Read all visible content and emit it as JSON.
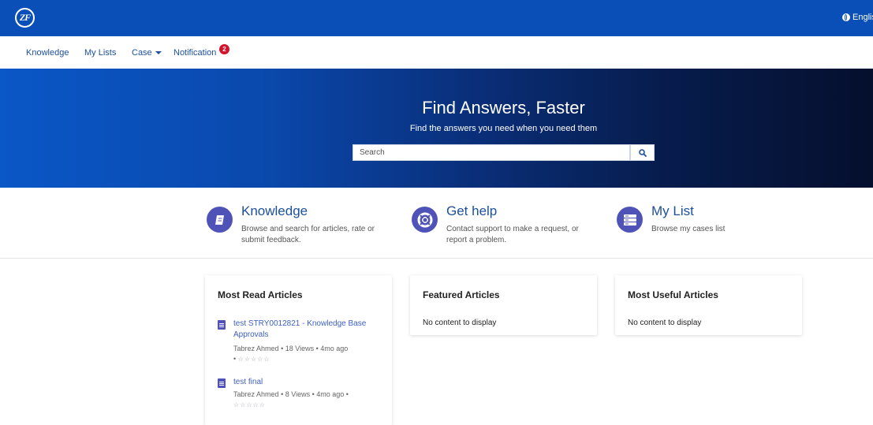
{
  "header": {
    "logo_text": "ZF",
    "language": "Englis"
  },
  "nav": {
    "items": [
      {
        "label": "Knowledge"
      },
      {
        "label": "My Lists"
      },
      {
        "label": "Case"
      },
      {
        "label": "Notification"
      }
    ],
    "notification_count": "2"
  },
  "hero": {
    "title": "Find Answers, Faster",
    "subtitle": "Find the answers you need when you need them",
    "search_placeholder": "Search"
  },
  "features": [
    {
      "title": "Knowledge",
      "description": "Browse and search for articles, rate or submit feedback.",
      "icon": "book-icon"
    },
    {
      "title": "Get help",
      "description": "Contact support to make a request, or report a problem.",
      "icon": "lifebuoy-icon"
    },
    {
      "title": "My List",
      "description": "Browse my cases list",
      "icon": "list-server-icon"
    }
  ],
  "cards": {
    "most_read": {
      "title": "Most Read Articles",
      "articles": [
        {
          "title": "test STRY0012821 - Knowledge Base Approvals",
          "author": "Tabrez Ahmed",
          "views": "18 Views",
          "age": "4mo ago",
          "rating": "☆☆☆☆☆"
        },
        {
          "title": "test final",
          "author": "Tabrez Ahmed",
          "views": "8 Views",
          "age": "4mo ago",
          "rating": "☆☆☆☆☆"
        }
      ]
    },
    "featured": {
      "title": "Featured Articles",
      "empty": "No content to display"
    },
    "most_useful": {
      "title": "Most Useful Articles",
      "empty": "No content to display"
    }
  },
  "colors": {
    "header_blue": "#0a4fb8",
    "link_blue": "#1c4f9c",
    "icon_purple": "#4f53b8",
    "badge_red": "#d3132b"
  }
}
